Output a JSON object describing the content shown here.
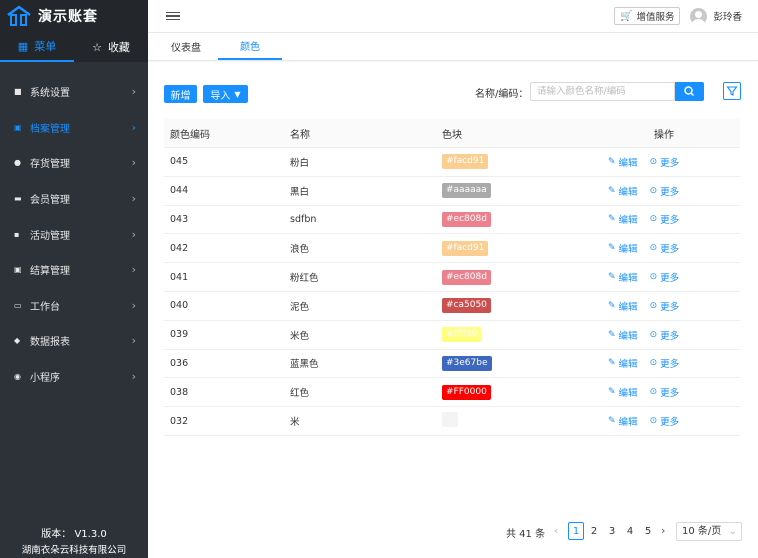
{
  "app": {
    "title": "演示账套"
  },
  "sidebar": {
    "tabs": [
      {
        "label": "菜单",
        "icon": "grid-icon"
      },
      {
        "label": "收藏",
        "icon": "star-icon"
      }
    ],
    "items": [
      {
        "label": "系统设置",
        "icon": "settings-icon"
      },
      {
        "label": "档案管理",
        "icon": "archive-icon",
        "active": true
      },
      {
        "label": "存货管理",
        "icon": "inventory-icon"
      },
      {
        "label": "会员管理",
        "icon": "member-icon"
      },
      {
        "label": "活动管理",
        "icon": "gift-icon"
      },
      {
        "label": "结算管理",
        "icon": "settlement-icon"
      },
      {
        "label": "工作台",
        "icon": "workbench-icon"
      },
      {
        "label": "数据报表",
        "icon": "report-icon"
      },
      {
        "label": "小程序",
        "icon": "miniprogram-icon"
      }
    ],
    "version": "版本： V1.3.0",
    "company": "湖南衣朵云科技有限公司"
  },
  "topbar": {
    "service_label": "增值服务",
    "username": "彭玲香"
  },
  "page_tabs": [
    {
      "label": "仪表盘"
    },
    {
      "label": "颜色",
      "active": true
    }
  ],
  "toolbar": {
    "add_label": "新增",
    "import_label": "导入",
    "search_label": "名称/编码：",
    "search_placeholder": "请输入颜色名称/编码"
  },
  "table": {
    "headers": {
      "code": "颜色编码",
      "name": "名称",
      "swatch": "色块",
      "actions": "操作"
    },
    "edit_label": "编辑",
    "more_label": "更多",
    "rows": [
      {
        "code": "045",
        "name": "粉白",
        "hex": "#facd91",
        "color": "#facd91"
      },
      {
        "code": "044",
        "name": "黑白",
        "hex": "#aaaaaa",
        "color": "#aaaaaa"
      },
      {
        "code": "043",
        "name": "sdfbn",
        "hex": "#ec808d",
        "color": "#ec808d"
      },
      {
        "code": "042",
        "name": "浪色",
        "hex": "#facd91",
        "color": "#facd91"
      },
      {
        "code": "041",
        "name": "粉红色",
        "hex": "#ec808d",
        "color": "#ec808d"
      },
      {
        "code": "040",
        "name": "泥色",
        "hex": "#ca5050",
        "color": "#ca5050"
      },
      {
        "code": "039",
        "name": "米色",
        "hex": "#ffff80",
        "color": "#ffff80"
      },
      {
        "code": "036",
        "name": "蓝黑色",
        "hex": "#3e67be",
        "color": "#3e67be"
      },
      {
        "code": "038",
        "name": "红色",
        "hex": "#FF0000",
        "color": "#FF0000"
      },
      {
        "code": "032",
        "name": "米",
        "hex": "",
        "color": "#f4f4f4"
      }
    ]
  },
  "pagination": {
    "total": "共 41 条",
    "pages": [
      "1",
      "2",
      "3",
      "4",
      "5"
    ],
    "current": "1",
    "page_size": "10 条/页"
  },
  "colors": {
    "accent": "#1890ff",
    "sidebar_bg": "#2d3238"
  }
}
